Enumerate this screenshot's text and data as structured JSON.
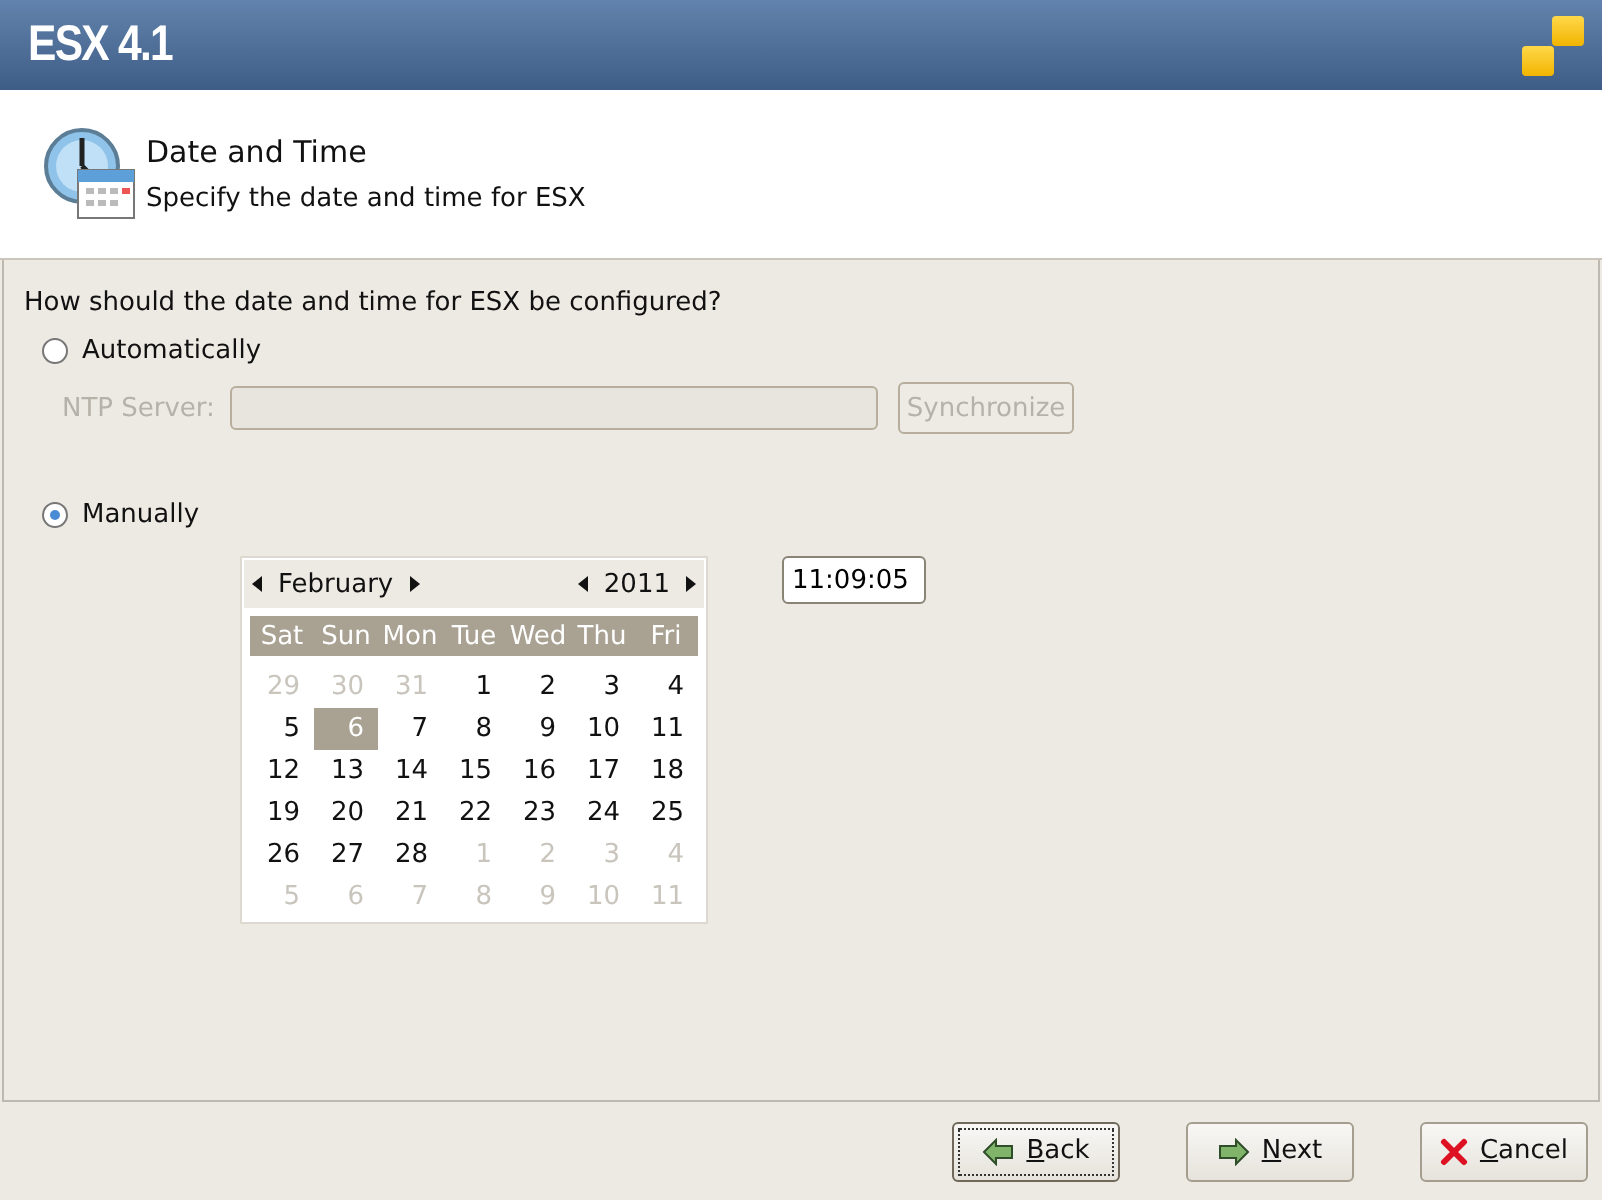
{
  "banner": {
    "title": "ESX 4.1"
  },
  "header": {
    "title": "Date and Time",
    "subtitle": "Specify the date and time for ESX"
  },
  "question": "How should the date and time for ESX be configured?",
  "options": [
    {
      "label": "Automatically",
      "selected": false
    },
    {
      "label": "Manually",
      "selected": true
    }
  ],
  "ntp": {
    "label": "NTP Server:",
    "disabled": true,
    "button": "Synchronize"
  },
  "calendar": {
    "month": "February",
    "year": "2011",
    "weekdays": [
      "Sat",
      "Sun",
      "Mon",
      "Tue",
      "Wed",
      "Thu",
      "Fri"
    ],
    "weeks": [
      [
        {
          "day": "29",
          "other_month": true,
          "selected": false
        },
        {
          "day": "30",
          "other_month": true,
          "selected": false
        },
        {
          "day": "31",
          "other_month": true,
          "selected": false
        },
        {
          "day": "1",
          "other_month": false,
          "selected": false
        },
        {
          "day": "2",
          "other_month": false,
          "selected": false
        },
        {
          "day": "3",
          "other_month": false,
          "selected": false
        },
        {
          "day": "4",
          "other_month": false,
          "selected": false
        }
      ],
      [
        {
          "day": "5",
          "other_month": false,
          "selected": false
        },
        {
          "day": "6",
          "other_month": false,
          "selected": true
        },
        {
          "day": "7",
          "other_month": false,
          "selected": false
        },
        {
          "day": "8",
          "other_month": false,
          "selected": false
        },
        {
          "day": "9",
          "other_month": false,
          "selected": false
        },
        {
          "day": "10",
          "other_month": false,
          "selected": false
        },
        {
          "day": "11",
          "other_month": false,
          "selected": false
        }
      ],
      [
        {
          "day": "12",
          "other_month": false,
          "selected": false
        },
        {
          "day": "13",
          "other_month": false,
          "selected": false
        },
        {
          "day": "14",
          "other_month": false,
          "selected": false
        },
        {
          "day": "15",
          "other_month": false,
          "selected": false
        },
        {
          "day": "16",
          "other_month": false,
          "selected": false
        },
        {
          "day": "17",
          "other_month": false,
          "selected": false
        },
        {
          "day": "18",
          "other_month": false,
          "selected": false
        }
      ],
      [
        {
          "day": "19",
          "other_month": false,
          "selected": false
        },
        {
          "day": "20",
          "other_month": false,
          "selected": false
        },
        {
          "day": "21",
          "other_month": false,
          "selected": false
        },
        {
          "day": "22",
          "other_month": false,
          "selected": false
        },
        {
          "day": "23",
          "other_month": false,
          "selected": false
        },
        {
          "day": "24",
          "other_month": false,
          "selected": false
        },
        {
          "day": "25",
          "other_month": false,
          "selected": false
        }
      ],
      [
        {
          "day": "26",
          "other_month": false,
          "selected": false
        },
        {
          "day": "27",
          "other_month": false,
          "selected": false
        },
        {
          "day": "28",
          "other_month": false,
          "selected": false
        },
        {
          "day": "1",
          "other_month": true,
          "selected": false
        },
        {
          "day": "2",
          "other_month": true,
          "selected": false
        },
        {
          "day": "3",
          "other_month": true,
          "selected": false
        },
        {
          "day": "4",
          "other_month": true,
          "selected": false
        }
      ],
      [
        {
          "day": "5",
          "other_month": true,
          "selected": false
        },
        {
          "day": "6",
          "other_month": true,
          "selected": false
        },
        {
          "day": "7",
          "other_month": true,
          "selected": false
        },
        {
          "day": "8",
          "other_month": true,
          "selected": false
        },
        {
          "day": "9",
          "other_month": true,
          "selected": false
        },
        {
          "day": "10",
          "other_month": true,
          "selected": false
        },
        {
          "day": "11",
          "other_month": true,
          "selected": false
        }
      ]
    ]
  },
  "time": {
    "value": "11:09:05"
  },
  "buttons": [
    {
      "kind": "back",
      "accel": "B",
      "rest": "ack",
      "focused": true
    },
    {
      "kind": "next",
      "accel": "N",
      "rest": "ext",
      "focused": false
    },
    {
      "kind": "cancel",
      "accel": "C",
      "rest": "ancel",
      "focused": false
    }
  ]
}
